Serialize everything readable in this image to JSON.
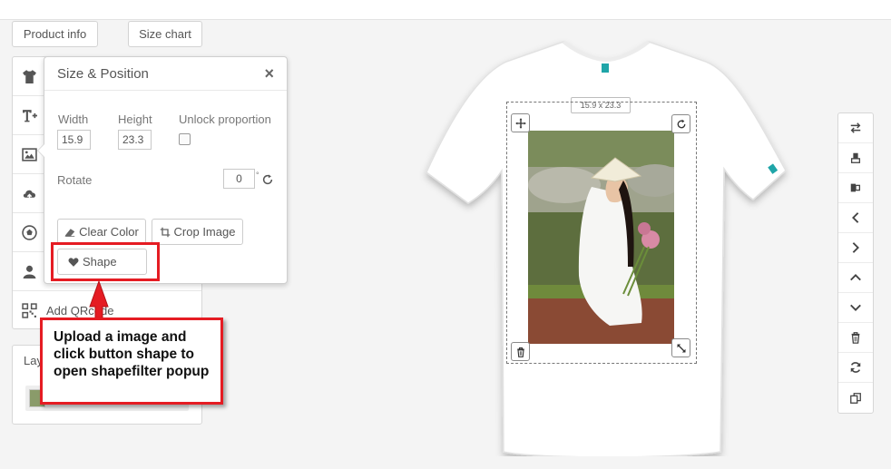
{
  "header": {
    "product_info_label": "Product info",
    "size_chart_label": "Size chart"
  },
  "toolbox": {
    "tools": [
      {
        "name": "tshirt-icon"
      },
      {
        "name": "add-text-icon"
      },
      {
        "name": "image-icon"
      },
      {
        "name": "upload-icon"
      },
      {
        "name": "clipart-icon"
      },
      {
        "name": "user-icon"
      },
      {
        "name": "qr-icon",
        "label": "Add QRcode"
      }
    ],
    "qr_label": "Add QRcode"
  },
  "layers": {
    "title": "Lay"
  },
  "popup": {
    "title": "Size & Position",
    "close_symbol": "×",
    "width_label": "Width",
    "width_value": "15.9",
    "height_label": "Height",
    "height_value": "23.3",
    "unlock_label": "Unlock proportion",
    "unlock_checked": false,
    "rotate_label": "Rotate",
    "rotate_value": "0",
    "degree_symbol": "°",
    "clear_color_label": "Clear Color",
    "crop_image_label": "Crop Image",
    "shape_label": "Shape"
  },
  "annotation": {
    "text": "Upload a image and click button shape to open shapefilter popup",
    "color": "#e51c23"
  },
  "design": {
    "size_badge": "15.9 x 23.3"
  },
  "right_toolbar": {
    "buttons": [
      "swap-icon",
      "align-center-vertical-icon",
      "align-center-horizontal-icon",
      "arrow-left-icon",
      "arrow-right-icon",
      "arrow-up-icon",
      "arrow-down-icon",
      "trash-icon",
      "refresh-icon",
      "duplicate-icon"
    ]
  },
  "colors": {
    "background": "#f4f4f4",
    "accent_red": "#e51c23",
    "icon_gray": "#555555"
  }
}
